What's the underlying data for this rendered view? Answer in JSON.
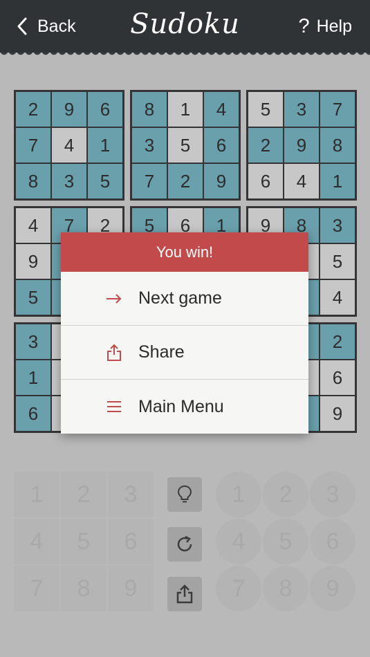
{
  "header": {
    "back_label": "Back",
    "title": "Sudoku",
    "help_icon": "?",
    "help_label": "Help"
  },
  "board": {
    "boxes": [
      [
        {
          "v": "2",
          "c": "b"
        },
        {
          "v": "9",
          "c": "b"
        },
        {
          "v": "6",
          "c": "b"
        },
        {
          "v": "7",
          "c": "b"
        },
        {
          "v": "4",
          "c": "g"
        },
        {
          "v": "1",
          "c": "b"
        },
        {
          "v": "8",
          "c": "b"
        },
        {
          "v": "3",
          "c": "b"
        },
        {
          "v": "5",
          "c": "b"
        }
      ],
      [
        {
          "v": "8",
          "c": "b"
        },
        {
          "v": "1",
          "c": "g"
        },
        {
          "v": "4",
          "c": "b"
        },
        {
          "v": "3",
          "c": "b"
        },
        {
          "v": "5",
          "c": "g"
        },
        {
          "v": "6",
          "c": "b"
        },
        {
          "v": "7",
          "c": "b"
        },
        {
          "v": "2",
          "c": "b"
        },
        {
          "v": "9",
          "c": "b"
        }
      ],
      [
        {
          "v": "5",
          "c": "g"
        },
        {
          "v": "3",
          "c": "b"
        },
        {
          "v": "7",
          "c": "b"
        },
        {
          "v": "2",
          "c": "b"
        },
        {
          "v": "9",
          "c": "b"
        },
        {
          "v": "8",
          "c": "b"
        },
        {
          "v": "6",
          "c": "g"
        },
        {
          "v": "4",
          "c": "g"
        },
        {
          "v": "1",
          "c": "b"
        }
      ],
      [
        {
          "v": "4",
          "c": "g"
        },
        {
          "v": "7",
          "c": "b"
        },
        {
          "v": "2",
          "c": "g"
        },
        {
          "v": "9",
          "c": "g"
        },
        {
          "v": "",
          "c": "b"
        },
        {
          "v": "",
          "c": "g"
        },
        {
          "v": "5",
          "c": "b"
        },
        {
          "v": "",
          "c": "b"
        },
        {
          "v": "",
          "c": "g"
        }
      ],
      [
        {
          "v": "5",
          "c": "b"
        },
        {
          "v": "6",
          "c": "g"
        },
        {
          "v": "1",
          "c": "b"
        },
        {
          "v": "",
          "c": "g"
        },
        {
          "v": "",
          "c": "b"
        },
        {
          "v": "",
          "c": "g"
        },
        {
          "v": "",
          "c": "b"
        },
        {
          "v": "",
          "c": "g"
        },
        {
          "v": "",
          "c": "b"
        }
      ],
      [
        {
          "v": "9",
          "c": "g"
        },
        {
          "v": "8",
          "c": "b"
        },
        {
          "v": "3",
          "c": "b"
        },
        {
          "v": "",
          "c": "b"
        },
        {
          "v": "",
          "c": "g"
        },
        {
          "v": "5",
          "c": "g"
        },
        {
          "v": "",
          "c": "b"
        },
        {
          "v": "",
          "c": "b"
        },
        {
          "v": "4",
          "c": "g"
        }
      ],
      [
        {
          "v": "3",
          "c": "b"
        },
        {
          "v": "",
          "c": "g"
        },
        {
          "v": "",
          "c": "b"
        },
        {
          "v": "1",
          "c": "b"
        },
        {
          "v": "",
          "c": "g"
        },
        {
          "v": "",
          "c": "b"
        },
        {
          "v": "6",
          "c": "b"
        },
        {
          "v": "",
          "c": "g"
        },
        {
          "v": "",
          "c": "b"
        }
      ],
      [
        {
          "v": "",
          "c": "g"
        },
        {
          "v": "",
          "c": "b"
        },
        {
          "v": "",
          "c": "g"
        },
        {
          "v": "",
          "c": "b"
        },
        {
          "v": "",
          "c": "g"
        },
        {
          "v": "",
          "c": "b"
        },
        {
          "v": "",
          "c": "g"
        },
        {
          "v": "",
          "c": "b"
        },
        {
          "v": "",
          "c": "g"
        }
      ],
      [
        {
          "v": "",
          "c": "g"
        },
        {
          "v": "",
          "c": "b"
        },
        {
          "v": "2",
          "c": "b"
        },
        {
          "v": "",
          "c": "b"
        },
        {
          "v": "",
          "c": "g"
        },
        {
          "v": "6",
          "c": "g"
        },
        {
          "v": "",
          "c": "b"
        },
        {
          "v": "",
          "c": "b"
        },
        {
          "v": "9",
          "c": "g"
        }
      ]
    ]
  },
  "keypad": {
    "left": [
      "1",
      "2",
      "3",
      "4",
      "5",
      "6",
      "7",
      "8",
      "9"
    ],
    "right": [
      "1",
      "2",
      "3",
      "4",
      "5",
      "6",
      "7",
      "8",
      "9"
    ],
    "tools": [
      {
        "name": "hint-button",
        "icon": "lightbulb-icon"
      },
      {
        "name": "restart-button",
        "icon": "refresh-icon"
      },
      {
        "name": "share-board-button",
        "icon": "share-icon"
      }
    ]
  },
  "dialog": {
    "title": "You win!",
    "items": [
      {
        "label": "Next game",
        "icon": "arrow-right-icon"
      },
      {
        "label": "Share",
        "icon": "share-icon"
      },
      {
        "label": "Main Menu",
        "icon": "menu-icon"
      }
    ]
  },
  "colors": {
    "header_bg": "#2f3336",
    "background": "#c2c2c2",
    "cell_blue": "#68a5b3",
    "cell_gray": "#d2d2d2",
    "dialog_header": "#c24a4a",
    "accent": "#c24a4a"
  }
}
